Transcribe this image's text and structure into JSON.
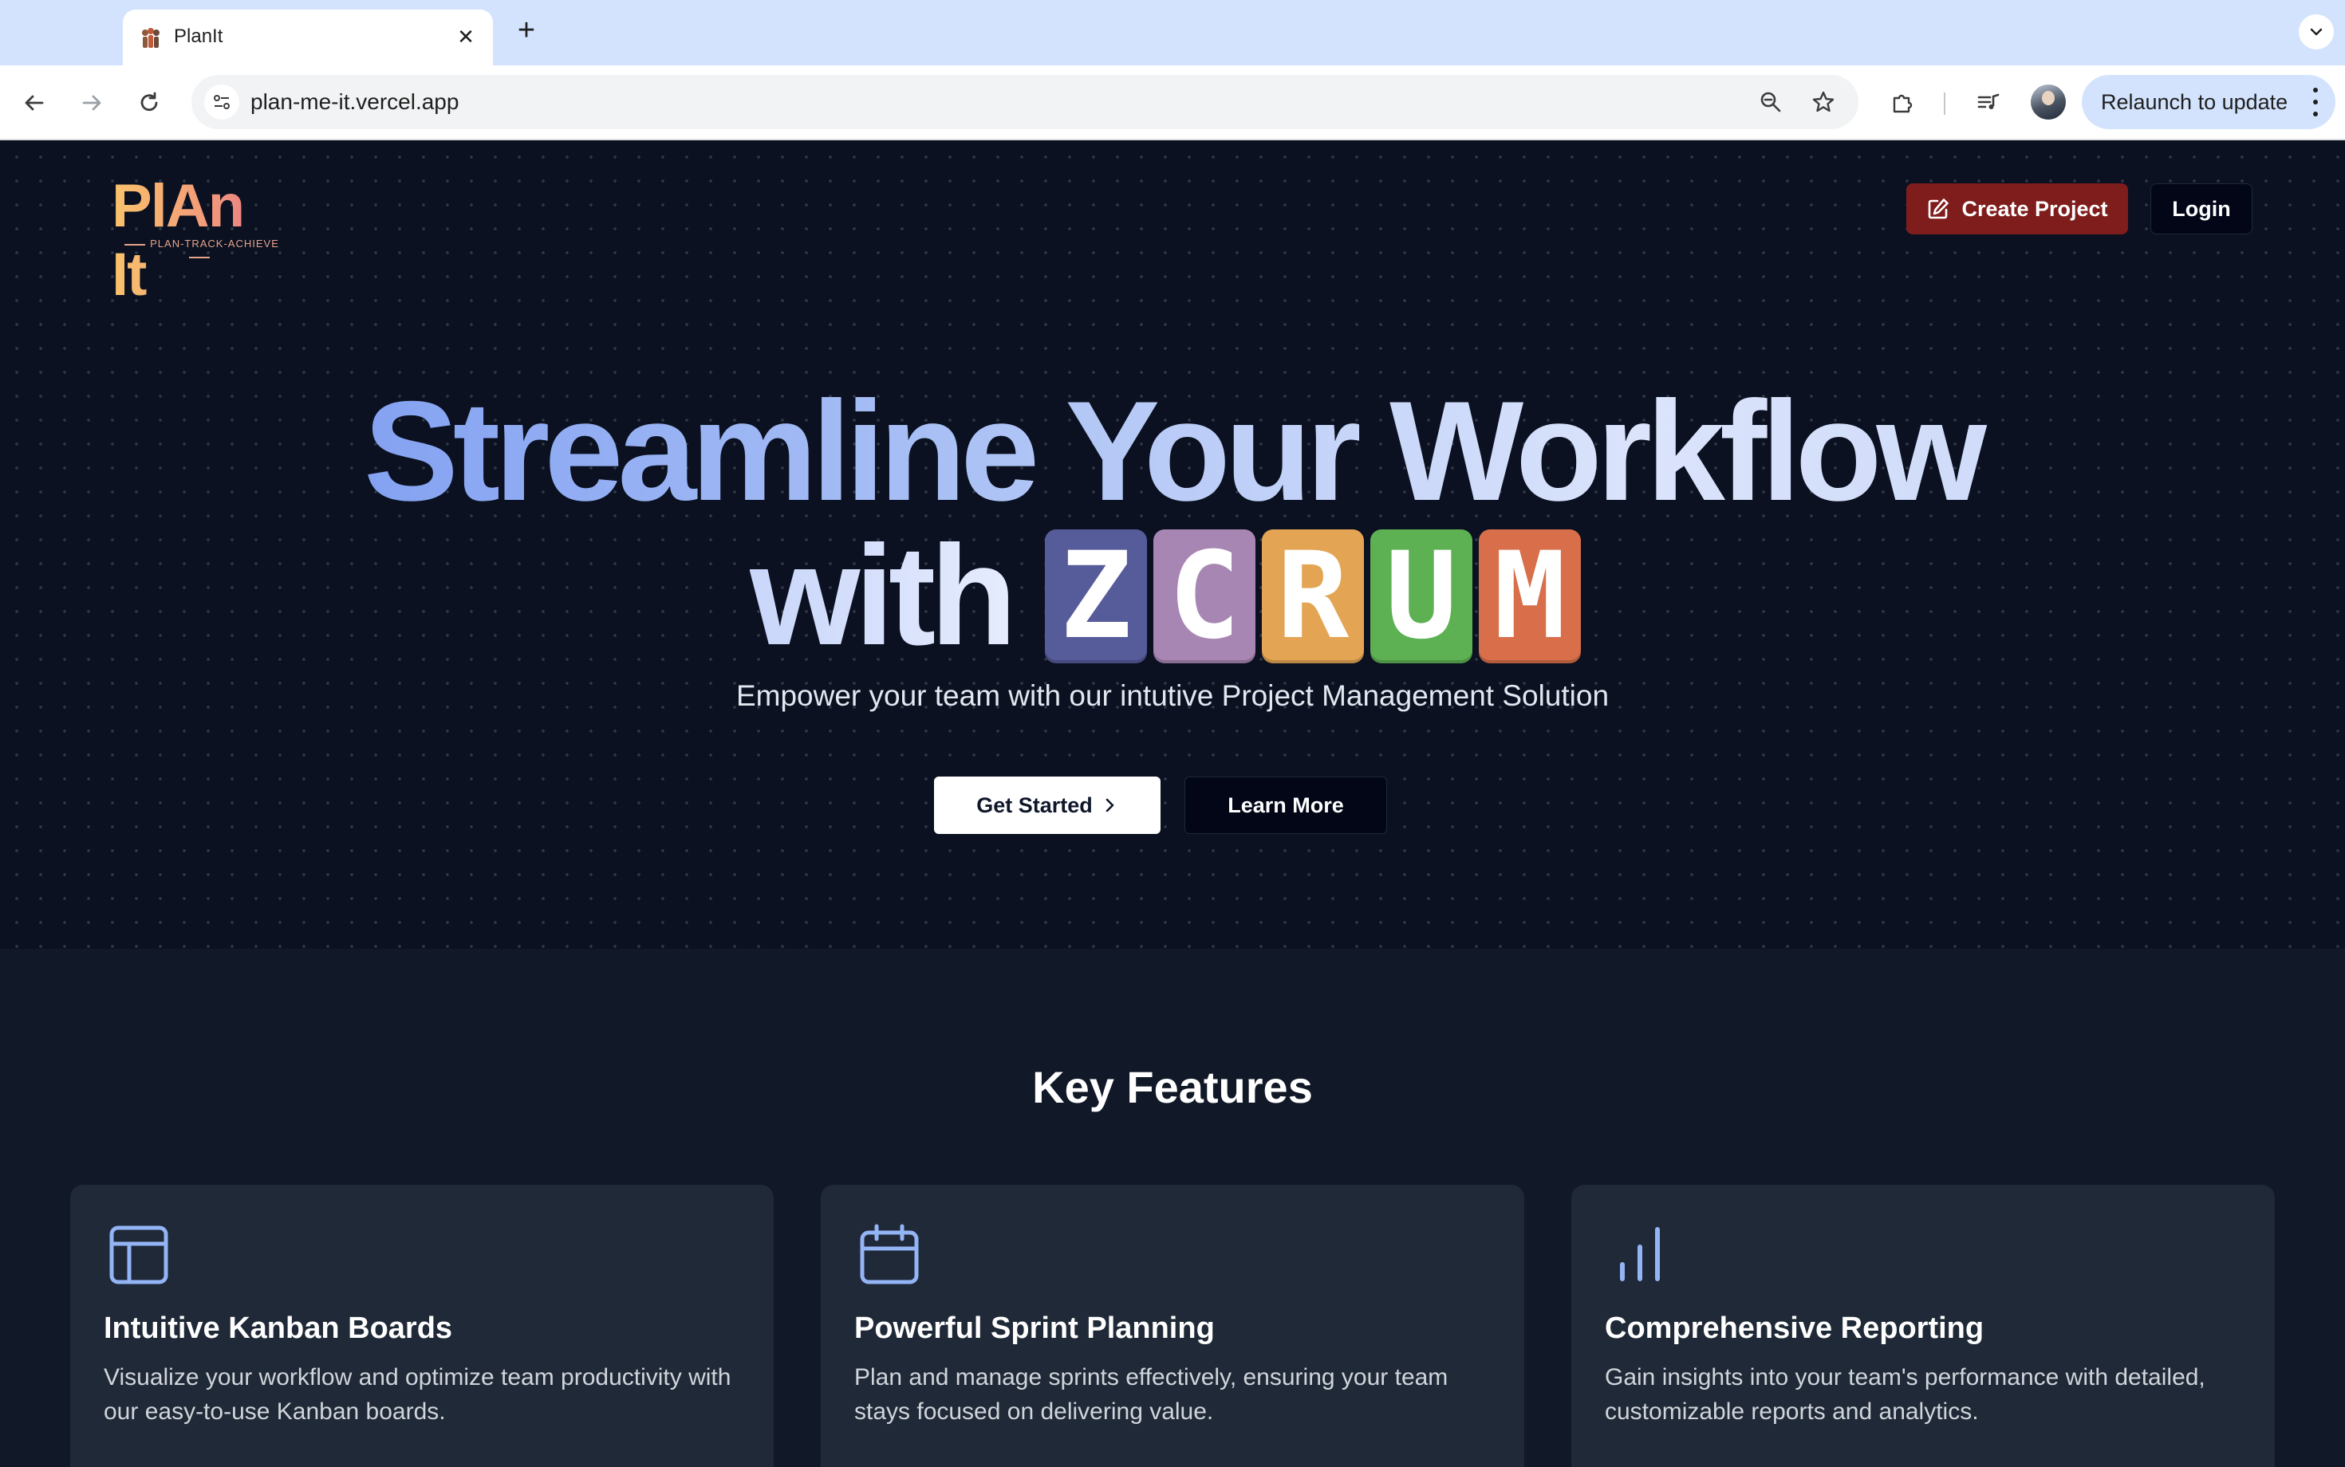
{
  "browser": {
    "tab_title": "PlanIt",
    "url": "plan-me-it.vercel.app",
    "relaunch_label": "Relaunch to update"
  },
  "nav": {
    "logo_text": "PlAn It",
    "logo_tagline": "PLAN-TRACK-ACHIEVE",
    "create_project_label": "Create Project",
    "login_label": "Login"
  },
  "hero": {
    "headline_line1": "Streamline Your Workflow",
    "headline_with": "with",
    "brand_letters": [
      {
        "letter": "Z",
        "color": "#565b9a"
      },
      {
        "letter": "C",
        "color": "#a886b3"
      },
      {
        "letter": "R",
        "color": "#e3a553"
      },
      {
        "letter": "U",
        "color": "#5db153"
      },
      {
        "letter": "M",
        "color": "#d86f4a"
      }
    ],
    "subtitle": "Empower your team with our intutive Project Management Solution",
    "get_started_label": "Get Started",
    "learn_more_label": "Learn More"
  },
  "features": {
    "title": "Key Features",
    "items": [
      {
        "icon": "layout-icon",
        "title": "Intuitive Kanban Boards",
        "description": "Visualize your workflow and optimize team productivity with our easy-to-use Kanban boards."
      },
      {
        "icon": "calendar-icon",
        "title": "Powerful Sprint Planning",
        "description": "Plan and manage sprints effectively, ensuring your team stays focused on delivering value."
      },
      {
        "icon": "bar-chart-icon",
        "title": "Comprehensive Reporting",
        "description": "Gain insights into your team's performance with detailed, customizable reports and analytics."
      }
    ]
  },
  "colors": {
    "accent_blue": "#6d8ff0",
    "create_button": "#7f1d1d",
    "page_bg": "#0b1120",
    "card_bg": "#1f2937"
  }
}
